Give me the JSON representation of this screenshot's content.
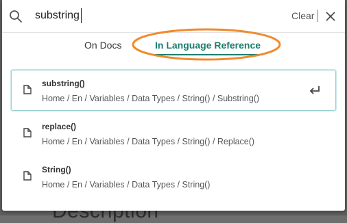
{
  "search": {
    "value": "substring",
    "clear_label": "Clear"
  },
  "tabs": [
    {
      "label": "On Docs",
      "active": false
    },
    {
      "label": "In Language Reference",
      "active": true
    }
  ],
  "results": [
    {
      "title": "substring()",
      "path": "Home / En / Variables / Data Types / String() / Substring()",
      "selected": true
    },
    {
      "title": "replace()",
      "path": "Home / En / Variables / Data Types / String() / Replace()",
      "selected": false
    },
    {
      "title": "String()",
      "path": "Home / En / Variables / Data Types / String()",
      "selected": false
    }
  ],
  "colors": {
    "accent": "#1a7f6e",
    "annotation": "#f08a2c",
    "selected_border": "#9bcfd0"
  },
  "icons": {
    "search": "search-icon",
    "close": "close-icon",
    "document": "document-icon",
    "enter": "enter-return-icon"
  }
}
